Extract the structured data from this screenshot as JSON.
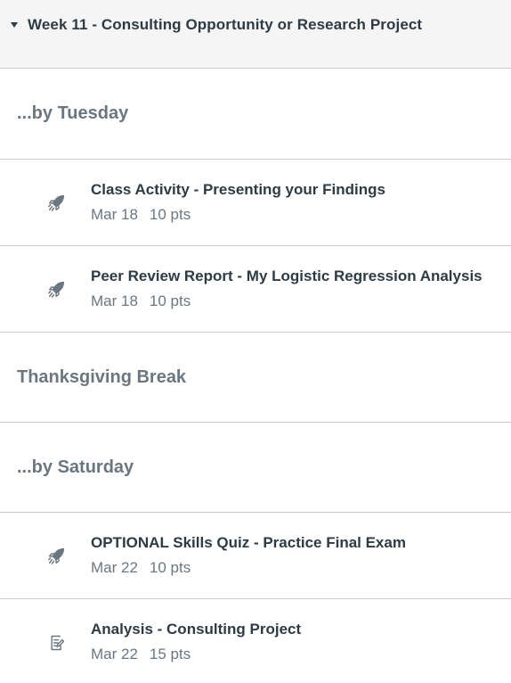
{
  "module": {
    "title": "Week 11 - Consulting Opportunity or Research Project"
  },
  "rows": {
    "sub1": "...by Tuesday",
    "item1": {
      "title": "Class Activity - Presenting your Findings",
      "date": "Mar 18",
      "points": "10 pts",
      "icon": "rocket-icon"
    },
    "item2": {
      "title": "Peer Review Report - My Logistic Regression Analysis",
      "date": "Mar 18",
      "points": "10 pts",
      "icon": "rocket-icon"
    },
    "sub2": "Thanksgiving Break",
    "sub3": "...by Saturday",
    "item3": {
      "title": "OPTIONAL Skills Quiz - Practice Final Exam",
      "date": "Mar 22",
      "points": "10 pts",
      "icon": "rocket-icon"
    },
    "item4": {
      "title": "Analysis - Consulting Project",
      "date": "Mar 22",
      "points": "15 pts",
      "icon": "assignment-icon"
    }
  },
  "colors": {
    "header_bg": "#f5f5f5",
    "border": "#c7cdd1",
    "text_primary": "#2d3b45",
    "text_secondary": "#6b7780"
  }
}
